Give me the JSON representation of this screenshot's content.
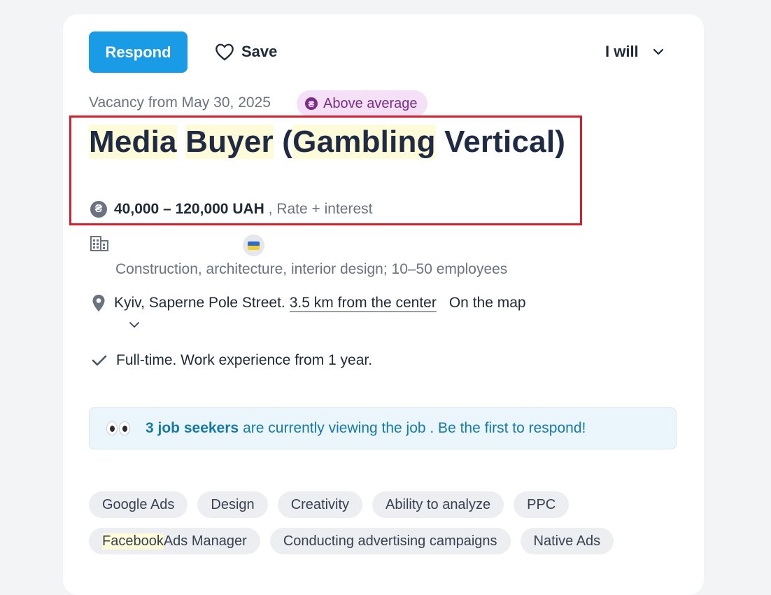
{
  "actions": {
    "respond_label": "Respond",
    "save_label": "Save",
    "i_will_label": "I will"
  },
  "vacancy": {
    "date_text": "Vacancy from May 30, 2025",
    "badge_label": "Above average",
    "title_words": [
      "Media",
      "Buyer",
      "(Gambling",
      "Vertical)"
    ],
    "salary_amount": "40,000 – 120,000 UAH",
    "salary_suffix": ", Rate + interest"
  },
  "company": {
    "description": "Construction, architecture, interior design; 10–50 employees"
  },
  "location": {
    "address": "Kyiv, Saperne Pole Street.",
    "distance": "3.5 km from the center",
    "map_link": "On the map"
  },
  "employment": {
    "text": "Full-time. Work experience from 1 year."
  },
  "viewers": {
    "count_text": "3 job seekers",
    "message": "are currently viewing the job . Be the first to respond!"
  },
  "tags": {
    "row1": [
      "Google Ads",
      "Design",
      "Creativity",
      "Ability to analyze",
      "PPC"
    ],
    "row2_first_highlight": "Facebook",
    "row2_first_rest": " Ads Manager",
    "row2": [
      "Conducting advertising campaigns",
      "Native Ads"
    ]
  },
  "colors": {
    "primary": "#1a9be6",
    "highlight": "#fefcd8",
    "annotation_border": "#d61f2c",
    "badge_bg": "#f5e1f7",
    "badge_text": "#7a2e86",
    "info_text": "#1679a8"
  },
  "icons": [
    "heart-icon",
    "chevron-down-icon",
    "hryvnia-coin-icon",
    "building-icon",
    "ukraine-flag-icon",
    "location-pin-icon",
    "checkmark-icon",
    "eyes-emoji-icon"
  ]
}
